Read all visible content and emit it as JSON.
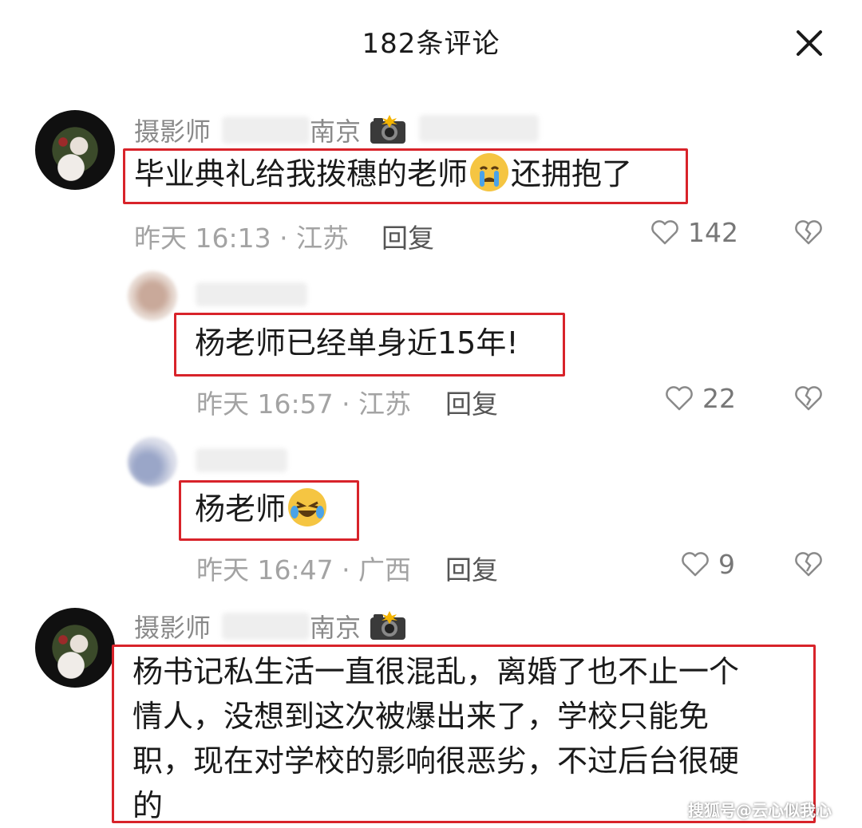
{
  "header": {
    "title": "182条评论"
  },
  "comments": [
    {
      "username": "摄影师",
      "location_suffix": "南京",
      "text_before_emoji": "毕业典礼给我拨穗的老师",
      "text_after_emoji": "还拥抱了",
      "emoji": "crying-face-icon",
      "meta": "昨天 16:13 · 江苏",
      "reply_label": "回复",
      "likes": "142"
    },
    {
      "text": "杨老师已经单身近15年!",
      "meta": "昨天 16:57 · 江苏",
      "reply_label": "回复",
      "likes": "22"
    },
    {
      "text": "杨老师",
      "emoji": "laughing-tears-icon",
      "meta": "昨天 16:47 · 广西",
      "reply_label": "回复",
      "likes": "9"
    },
    {
      "username": "摄影师",
      "location_suffix": "南京",
      "lines": [
        "杨书记私生活一直很混乱，离婚了也不止一个",
        "情人，没想到这次被爆出来了，学校只能免",
        "职，现在对学校的影响很恶劣，不过后台很硬",
        "的"
      ]
    }
  ],
  "watermark": "搜狐号@云心似我心",
  "colors": {
    "highlight": "#d8232a",
    "meta_gray": "#a3a3a3"
  }
}
